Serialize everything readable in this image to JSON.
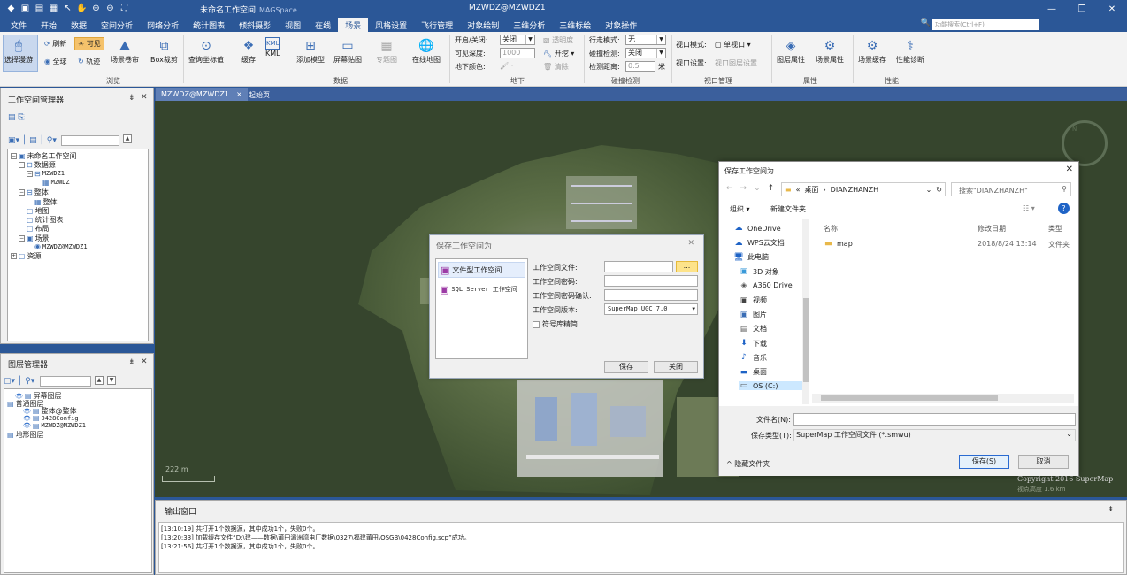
{
  "window": {
    "app_title": "未命名工作空间",
    "app_subtitle": "MAGSpace",
    "doc_title": "MZWDZ@MZWDZ1",
    "quick_icons": [
      "app-logo-icon",
      "new-icon",
      "open-icon",
      "save-icon",
      "pointer-icon",
      "pan-icon",
      "zoom-in-icon",
      "zoom-out-icon",
      "fullscreen-icon"
    ],
    "controls": {
      "minimize": "—",
      "restore": "❐",
      "close": "✕"
    }
  },
  "menu": {
    "items": [
      "文件",
      "开始",
      "数据",
      "空间分析",
      "网络分析",
      "统计图表",
      "倾斜摄影",
      "视图",
      "在线",
      "场景",
      "风格设置",
      "飞行管理",
      "对象绘制",
      "三维分析",
      "三维标绘",
      "对象操作"
    ],
    "active": "场景",
    "search_placeholder": "功能搜索(Ctrl+F)"
  },
  "ribbon": {
    "browse": {
      "select_roam": "选择漫游",
      "refresh": "刷新",
      "visible": "可见",
      "full": "全球",
      "track": "轨迹",
      "scene_roll": "场景卷帘",
      "box_clip": "Box裁剪",
      "group": "浏览"
    },
    "coord": {
      "query_coord": "查询坐标值"
    },
    "data": {
      "cache": "缓存",
      "kml": "KML",
      "add_model": "添加模型",
      "screen_tex": "屏幕贴图",
      "topo": "专题图",
      "online_map": "在线地图",
      "group": "数据"
    },
    "underground": {
      "toggle_label": "开启/关闭:",
      "toggle_value": "关闭",
      "depth_label": "可见深度:",
      "depth_value": "1000",
      "color_label": "地下颜色:",
      "transparency": "透明度",
      "excavate": "开挖",
      "clear": "清除",
      "group": "地下"
    },
    "collision": {
      "mode_label": "行走模式:",
      "mode_value": "无",
      "detect_label": "碰撞检测:",
      "detect_value": "关闭",
      "dist_label": "检测距离:",
      "dist_value": "0.5",
      "dist_unit": "米",
      "group": "碰撞检测"
    },
    "viewport": {
      "mode_label": "视口模式:",
      "mode_value": "单视口",
      "setting_label": "视口设置:",
      "setting_value": "视口图层设置...",
      "group": "视口管理"
    },
    "properties": {
      "layer_prop": "图层属性",
      "scene_prop": "场景属性",
      "group": "属性"
    },
    "perf": {
      "scene_cache": "场景缓存",
      "diagnose": "性能诊断",
      "group": "性能"
    }
  },
  "workspace_panel": {
    "title": "工作空间管理器",
    "nodes": [
      {
        "label": "未命名工作空间",
        "depth": 0
      },
      {
        "label": "数据源",
        "depth": 1
      },
      {
        "label": "MZWDZ1",
        "depth": 2,
        "mono": true
      },
      {
        "label": "MZWDZ",
        "depth": 3,
        "mono": true
      },
      {
        "label": "整体",
        "depth": 1
      },
      {
        "label": "整体",
        "depth": 2
      },
      {
        "label": "地图",
        "depth": 1
      },
      {
        "label": "统计图表",
        "depth": 1
      },
      {
        "label": "布局",
        "depth": 1
      },
      {
        "label": "场景",
        "depth": 1
      },
      {
        "label": "MZWDZ@MZWDZ1",
        "depth": 2,
        "mono": true
      },
      {
        "label": "资源",
        "depth": 0
      }
    ]
  },
  "layer_panel": {
    "title": "图层管理器",
    "nodes": [
      {
        "label": "屏幕图层",
        "depth": 1
      },
      {
        "label": "普通图层",
        "depth": 0
      },
      {
        "label": "整体@整体",
        "depth": 2
      },
      {
        "label": "0428Config",
        "depth": 2,
        "mono": true
      },
      {
        "label": "MZWDZ@MZWDZ1",
        "depth": 2,
        "mono": true
      },
      {
        "label": "地形图层",
        "depth": 0
      }
    ]
  },
  "tabs": {
    "active": "MZWDZ@MZWDZ1",
    "other": "起始页",
    "close": "×"
  },
  "map": {
    "scale": "222 m",
    "copyright_1": "Copyright 2016 SuperMap",
    "copyright_2": "视点高度 1.6 km"
  },
  "output": {
    "title": "输出窗口",
    "lines": [
      "[13:10:19] 共打开1个数据源，其中成功1个，失败0个。",
      "[13:20:33] 加载缓存文件“D:\\建——数据\\莆田湄洲湾电厂数据\\0327\\福建莆田\\OSGB\\0428Config.scp”成功。",
      "[13:21:56] 共打开1个数据源，其中成功1个，失败0个。"
    ]
  },
  "save_ws_dialog": {
    "title": "保存工作空间为",
    "types": [
      "文件型工作空间",
      "SQL Server 工作空间"
    ],
    "file_label": "工作空间文件:",
    "pwd_label": "工作空间密码:",
    "pwd_confirm_label": "工作空间密码确认:",
    "version_label": "工作空间版本:",
    "version_value": "SuperMap UGC 7.0",
    "symbol_checkbox": "符号库精简",
    "browse": "...",
    "save": "保存",
    "close": "关闭"
  },
  "file_dialog": {
    "title": "保存工作空间为",
    "path": [
      "«",
      "桌面",
      "DIANZHANZH"
    ],
    "search_placeholder": "搜索\"DIANZHANZH\"",
    "organize": "组织 ▾",
    "new_folder": "新建文件夹",
    "columns": {
      "name": "名称",
      "date": "修改日期",
      "type": "类型"
    },
    "files": [
      {
        "name": "map",
        "date": "2018/8/24 13:14",
        "type": "文件夹"
      }
    ],
    "nav": [
      "OneDrive",
      "WPS云文档",
      "此电脑",
      "3D 对象",
      "A360 Drive",
      "视频",
      "图片",
      "文档",
      "下载",
      "音乐",
      "桌面",
      "OS (C:)"
    ],
    "filename_label": "文件名(N):",
    "filename_value": "",
    "filetype_label": "保存类型(T):",
    "filetype_value": "SuperMap 工作空间文件 (*.smwu)",
    "hide_folders": "隐藏文件夹",
    "save": "保存(S)",
    "cancel": "取消"
  }
}
